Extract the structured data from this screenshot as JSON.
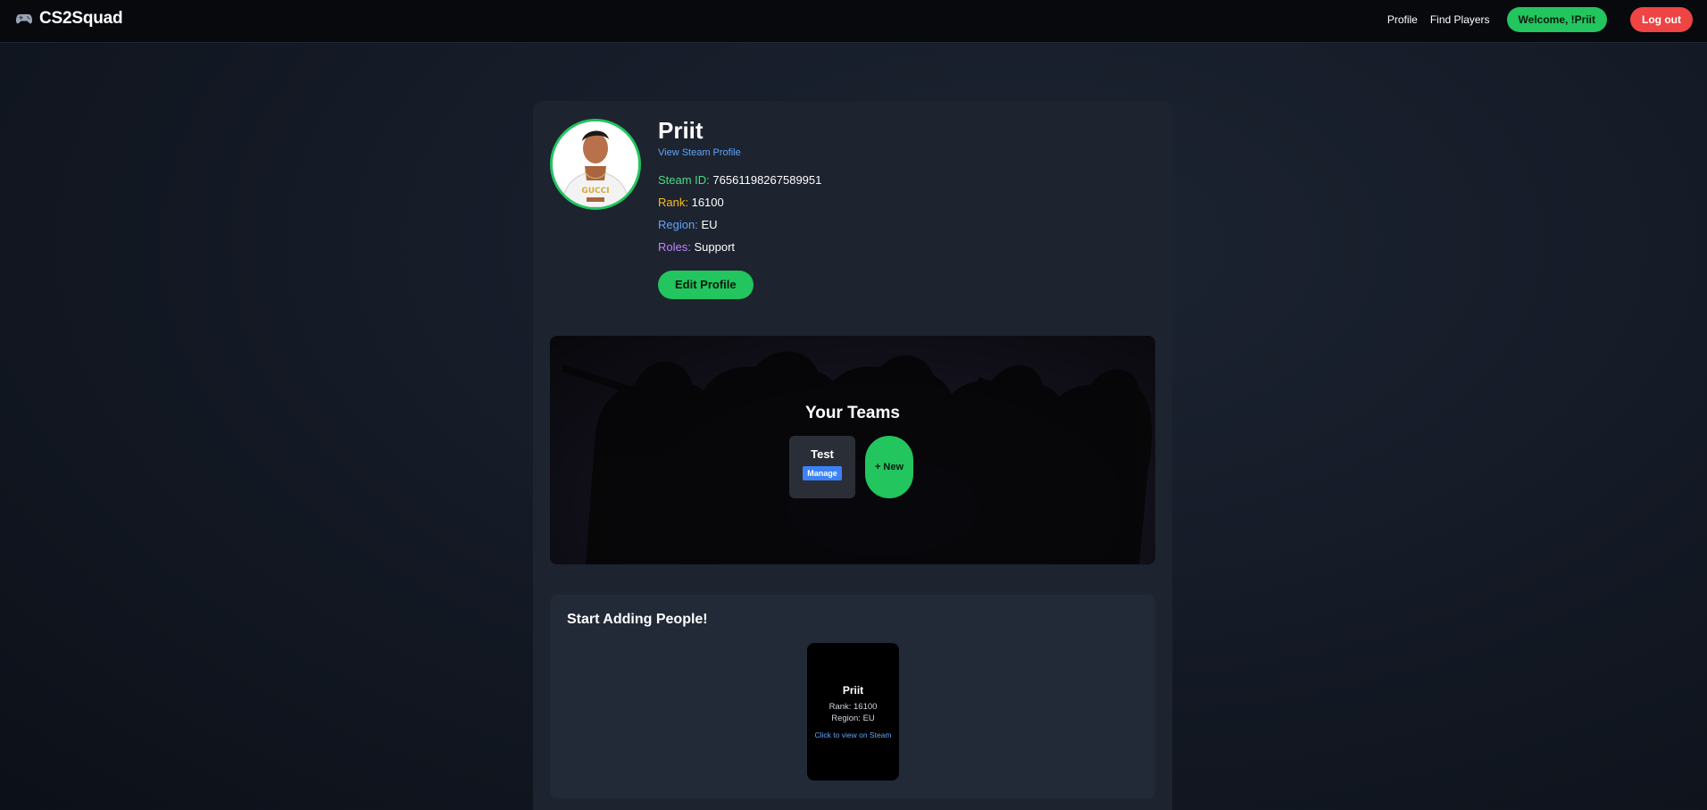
{
  "nav": {
    "brand": "CS2Squad",
    "brand_icon": "gamepad-icon",
    "links": [
      "Profile",
      "Find Players"
    ],
    "welcome": "Welcome, !Priit",
    "logout": "Log out",
    "colors": {
      "welcome": "#22c55e",
      "logout": "#ef4444"
    }
  },
  "profile": {
    "name": "Priit",
    "steam_link": "View Steam Profile",
    "steam_id_label": "Steam ID:",
    "steam_id": "76561198267589951",
    "rank_label": "Rank:",
    "rank": "16100",
    "region_label": "Region:",
    "region": "EU",
    "roles_label": "Roles:",
    "roles": "Support",
    "edit_button": "Edit Profile"
  },
  "teams": {
    "title": "Your Teams",
    "items": [
      {
        "name": "Test",
        "manage_label": "Manage"
      }
    ],
    "new_label": "+ New"
  },
  "adding": {
    "title": "Start Adding People!",
    "players": [
      {
        "name": "Priit",
        "rank": "Rank: 16100",
        "region": "Region: EU",
        "link": "Click to view on Steam"
      }
    ]
  }
}
